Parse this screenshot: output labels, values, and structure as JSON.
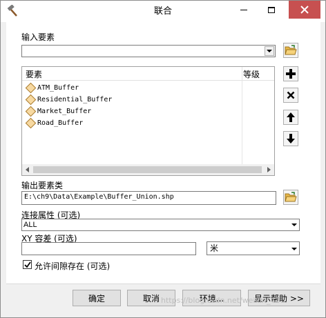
{
  "window": {
    "title": "联合",
    "app_icon": "hammer-icon",
    "controls": [
      "minimize-icon",
      "maximize-icon",
      "close-icon"
    ]
  },
  "input_features": {
    "label": "输入要素",
    "value": "",
    "browse_icon": "open-folder-icon"
  },
  "feature_list": {
    "col_features": "要素",
    "col_rank": "等级",
    "items": [
      "ATM_Buffer",
      "Residential_Buffer",
      "Market_Buffer",
      "Road_Buffer"
    ],
    "item_icon": "polygon-layer-icon"
  },
  "side_buttons": {
    "add": "plus-icon",
    "remove": "x-icon",
    "up": "arrow-up-icon",
    "down": "arrow-down-icon"
  },
  "output": {
    "label": "输出要素类",
    "value": "E:\\ch9\\Data\\Example\\Buffer_Union.shp",
    "browse_icon": "open-folder-icon"
  },
  "join_attributes": {
    "label": "连接属性 (可选)",
    "value": "ALL"
  },
  "xy_tolerance": {
    "label": "XY 容差 (可选)",
    "value": "",
    "unit": "米"
  },
  "gaps": {
    "label": "允许间隙存在 (可选)",
    "checked": true
  },
  "buttons": {
    "ok": "确定",
    "cancel": "取消",
    "environments": "环境...",
    "help": "显示帮助 >>"
  },
  "watermark": "https://blog.csdn.net/weixin_42..."
}
